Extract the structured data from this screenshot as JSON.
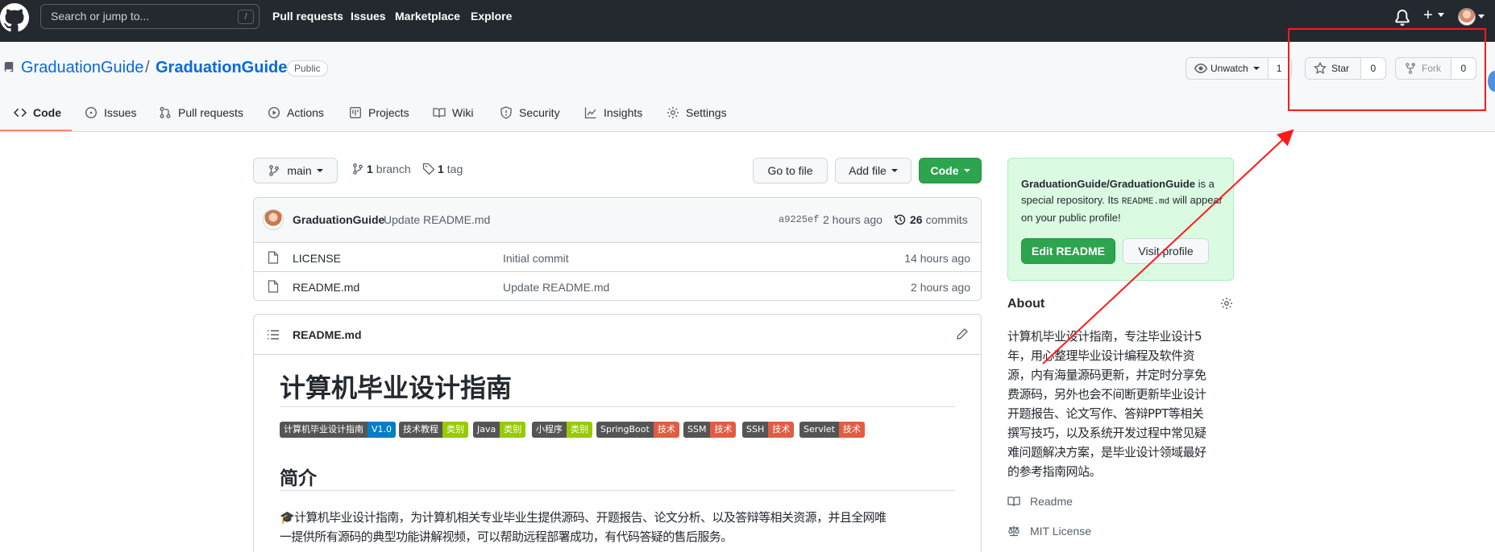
{
  "topbar": {
    "search_placeholder": "Search or jump to...",
    "search_shortcut": "/",
    "nav": [
      "Pull requests",
      "Issues",
      "Marketplace",
      "Explore"
    ]
  },
  "repo": {
    "owner": "GraduationGuide",
    "separator": "/",
    "name": "GraduationGuide",
    "visibility": "Public",
    "unwatch_label": "Unwatch",
    "watch_count": "1",
    "star_label": "Star",
    "star_count": "0",
    "fork_label": "Fork",
    "fork_count": "0"
  },
  "tabs": [
    {
      "label": "Code",
      "icon": "code-icon"
    },
    {
      "label": "Issues",
      "icon": "issue-icon"
    },
    {
      "label": "Pull requests",
      "icon": "pull-request-icon"
    },
    {
      "label": "Actions",
      "icon": "play-icon"
    },
    {
      "label": "Projects",
      "icon": "project-icon"
    },
    {
      "label": "Wiki",
      "icon": "book-icon"
    },
    {
      "label": "Security",
      "icon": "shield-icon"
    },
    {
      "label": "Insights",
      "icon": "graph-icon"
    },
    {
      "label": "Settings",
      "icon": "gear-icon"
    }
  ],
  "branchbar": {
    "branch": "main",
    "branch_count": "1",
    "branch_word": "branch",
    "tag_count": "1",
    "tag_word": "tag",
    "go_to_file": "Go to file",
    "add_file": "Add file",
    "code": "Code"
  },
  "commit": {
    "author": "GraduationGuide",
    "message": "Update README.md",
    "sha": "a9225ef",
    "time": "2 hours ago",
    "commit_count": "26",
    "commit_word": "commits"
  },
  "files": [
    {
      "name": "LICENSE",
      "message": "Initial commit",
      "time": "14 hours ago"
    },
    {
      "name": "README.md",
      "message": "Update README.md",
      "time": "2 hours ago"
    }
  ],
  "readme": {
    "filename": "README.md",
    "title": "计算机毕业设计指南",
    "badges": [
      {
        "left": "计算机毕业设计指南",
        "right": "V1.0",
        "color": "#007ec6"
      },
      {
        "left": "技术教程",
        "right": "类别",
        "color": "#97ca00"
      },
      {
        "left": "Java",
        "right": "类别",
        "color": "#97ca00"
      },
      {
        "left": "小程序",
        "right": "类别",
        "color": "#97ca00"
      },
      {
        "left": "SpringBoot",
        "right": "技术",
        "color": "#e05d44"
      },
      {
        "left": "SSM",
        "right": "技术",
        "color": "#e05d44"
      },
      {
        "left": "SSH",
        "right": "技术",
        "color": "#e05d44"
      },
      {
        "left": "Servlet",
        "right": "技术",
        "color": "#e05d44"
      }
    ],
    "section_title": "简介",
    "intro_line1": "🎓计算机毕业设计指南，为计算机相关专业毕业生提供源码、开题报告、论文分析、以及答辩等相关资源，并且全网唯",
    "intro_line2": "一提供所有源码的典型功能讲解视频，可以帮助远程部署成功，有代码答疑的售后服务。"
  },
  "profile_card": {
    "title": "GraduationGuide/GraduationGuide",
    "text1": "is",
    "text2": "a special repository. Its",
    "code": "README.md",
    "text3": "will",
    "text4": "appear on your public profile!",
    "edit_button": "Edit README",
    "visit_button": "Visit profile"
  },
  "about": {
    "heading": "About",
    "lines": [
      "计算机毕业设计指南，专注毕业设计5",
      "年，用心整理毕业设计编程及软件资",
      "源，内有海量源码更新，并定时分享免",
      "费源码，另外也会不间断更新毕业设计",
      "开题报告、论文写作、答辩PPT等相关",
      "撰写技巧，以及系统开发过程中常见疑",
      "难问题解决方案，是毕业设计领域最好",
      "的参考指南网站。"
    ],
    "readme_link": "Readme",
    "license_link": "MIT License"
  },
  "colors": {
    "annotation": "#ff1a1a",
    "accent_green": "#2da44e",
    "link_blue": "#0969da"
  }
}
